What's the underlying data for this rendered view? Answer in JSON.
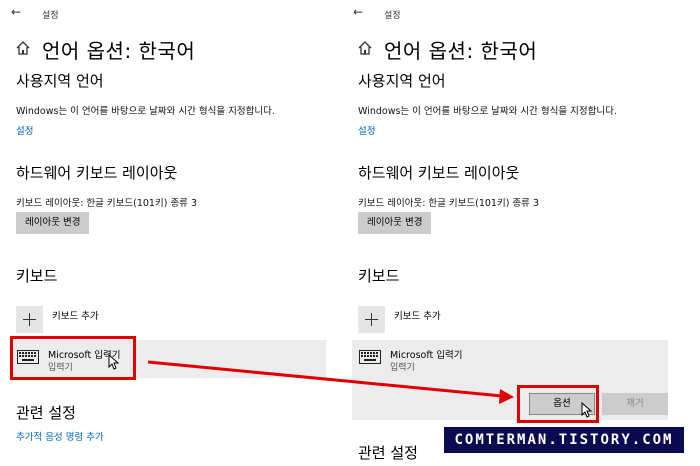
{
  "header": {
    "back_glyph": "←",
    "title": "설정"
  },
  "page_title": "언어 옵션: 한국어",
  "region": {
    "heading": "사용지역 언어",
    "description": "Windows는 이 언어를 바탕으로 날짜와 시간 형식을 지정합니다.",
    "link": "설정"
  },
  "hardware": {
    "heading": "하드웨어 키보드 레이아웃",
    "layout_text": "키보드 레이아웃:  한글 키보드(101키) 종류 3",
    "change_button": "레이아웃 변경"
  },
  "keyboards": {
    "heading": "키보드",
    "add_label": "키보드 추가",
    "item_name": "Microsoft 입력기",
    "item_sub": "입력기",
    "options_button": "옵션",
    "remove_button": "제거"
  },
  "related": {
    "heading": "관련 설정",
    "link": "추가적 음성 명령 추가"
  },
  "watermark": "COMTERMAN.TISTORY.COM",
  "colors": {
    "link": "#0067b8",
    "highlight": "#e00000",
    "watermark_bg": "#0a0a52"
  }
}
